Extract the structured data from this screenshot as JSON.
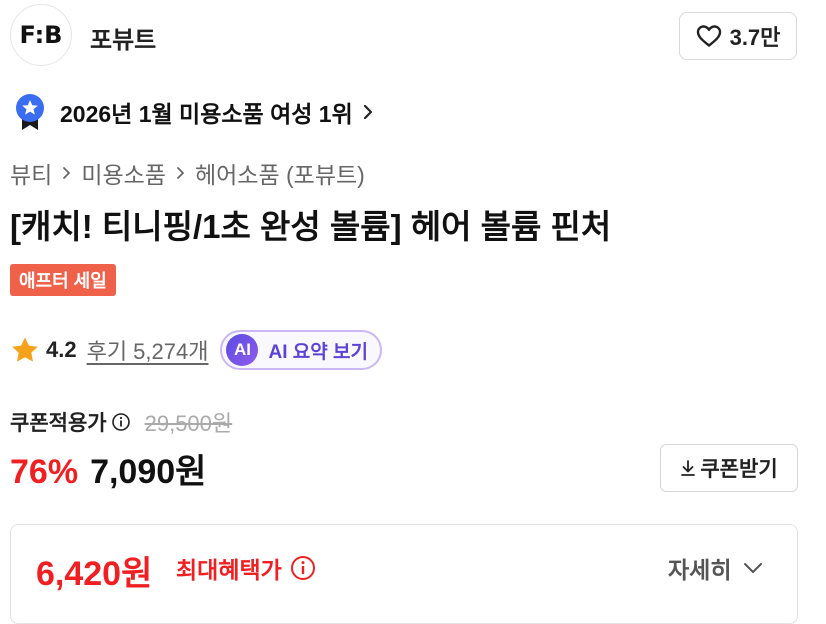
{
  "brand": {
    "logo_text": "F:B",
    "name": "포뷰트",
    "like_count": "3.7만"
  },
  "ranking": {
    "text": "2026년 1월 미용소품 여성 1위"
  },
  "breadcrumb": [
    "뷰티",
    "미용소품",
    "헤어소품 (포뷰트)"
  ],
  "product": {
    "title": "[캐치! 티니핑/1초 완성 볼륨] 헤어 볼륨 핀처",
    "sale_badge": "애프터 세일"
  },
  "rating": {
    "score": "4.2",
    "reviews": "후기 5,274개",
    "ai_badge": "AI",
    "ai_summary": "AI 요약 보기"
  },
  "pricing": {
    "coupon_label": "쿠폰적용가",
    "original_price": "29,500원",
    "discount": "76%",
    "price": "7,090원",
    "coupon_button": "쿠폰받기"
  },
  "benefit": {
    "price": "6,420원",
    "label": "최대혜택가",
    "detail": "자세히"
  },
  "colors": {
    "accent_red": "#f01f22",
    "sale_badge": "#f0614a",
    "ai_purple": "#5a43d6",
    "star": "#f7a21b",
    "rank_badge": "#3a6df0"
  },
  "icons": [
    "heart-icon",
    "ranking-medal-icon",
    "chevron-right-icon",
    "star-icon",
    "info-icon",
    "download-icon",
    "chevron-down-icon"
  ]
}
